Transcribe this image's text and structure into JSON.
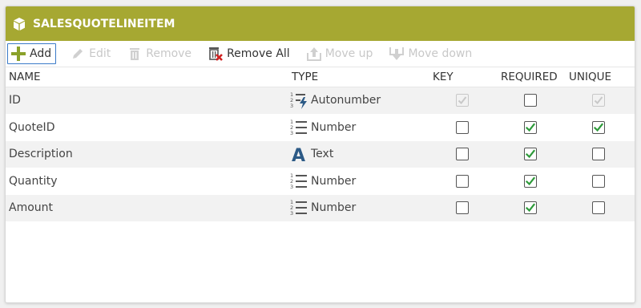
{
  "title": "SALESQUOTELINEITEM",
  "toolbar": {
    "add": "Add",
    "edit": "Edit",
    "remove": "Remove",
    "remove_all": "Remove All",
    "move_up": "Move up",
    "move_down": "Move down"
  },
  "columns": {
    "name": "NAME",
    "type": "TYPE",
    "key": "KEY",
    "required": "REQUIRED",
    "unique": "UNIQUE"
  },
  "rows": [
    {
      "name": "ID",
      "type": "Autonumber",
      "type_icon": "autonumber-icon",
      "key": true,
      "key_disabled": true,
      "required": false,
      "unique": true,
      "unique_disabled": true
    },
    {
      "name": "QuoteID",
      "type": "Number",
      "type_icon": "number-icon",
      "key": false,
      "required": true,
      "unique": true
    },
    {
      "name": "Description",
      "type": "Text",
      "type_icon": "text-icon",
      "key": false,
      "required": true,
      "unique": false
    },
    {
      "name": "Quantity",
      "type": "Number",
      "type_icon": "number-icon",
      "key": false,
      "required": true,
      "unique": false
    },
    {
      "name": "Amount",
      "type": "Number",
      "type_icon": "number-icon",
      "key": false,
      "required": true,
      "unique": false
    }
  ],
  "colors": {
    "header_bar": "#a6a832",
    "check_green": "#2e9a3a",
    "add_plus": "#8aa12a",
    "remove_all_x": "#d02020",
    "type_icon_blue": "#2c5a86"
  }
}
